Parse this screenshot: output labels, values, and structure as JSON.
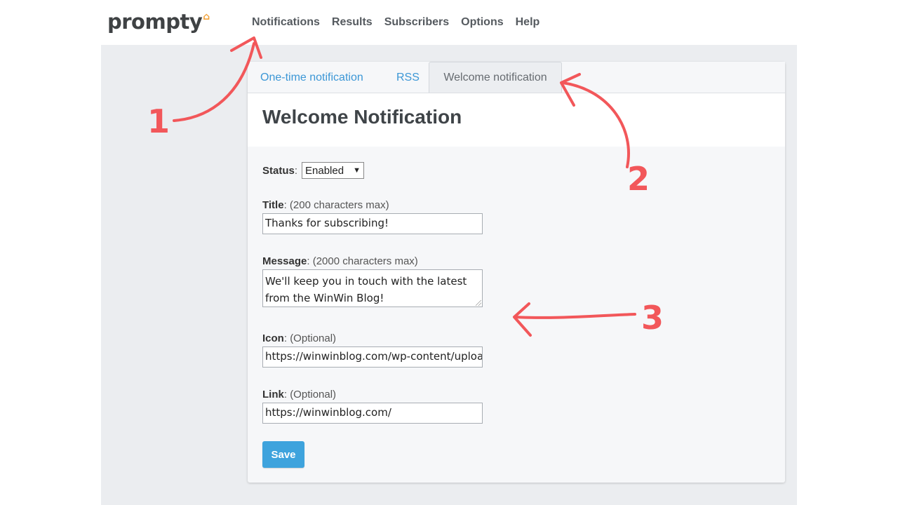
{
  "brand": {
    "name": "prompty"
  },
  "topnav": [
    "Notifications",
    "Results",
    "Subscribers",
    "Options",
    "Help"
  ],
  "tabs": [
    {
      "label": "One-time notification",
      "active": false
    },
    {
      "label": "RSS",
      "active": false
    },
    {
      "label": "Welcome notification",
      "active": true
    }
  ],
  "page_title": "Welcome Notification",
  "form": {
    "status": {
      "label": "Status",
      "value": "Enabled"
    },
    "title": {
      "label": "Title",
      "hint": "(200 characters max)",
      "value": "Thanks for subscribing!"
    },
    "message": {
      "label": "Message",
      "hint": "(2000 characters max)",
      "value": "We'll keep you in touch with the latest from the WinWin Blog!"
    },
    "icon": {
      "label": "Icon",
      "hint": "(Optional)",
      "value": "https://winwinblog.com/wp-content/uploads/"
    },
    "link": {
      "label": "Link",
      "hint": "(Optional)",
      "value": "https://winwinblog.com/"
    },
    "save_label": "Save"
  },
  "annotations": [
    "1",
    "2",
    "3"
  ],
  "colors": {
    "accent": "#3ea3dd",
    "annotation": "#f2575a",
    "link": "#3c97d6"
  }
}
